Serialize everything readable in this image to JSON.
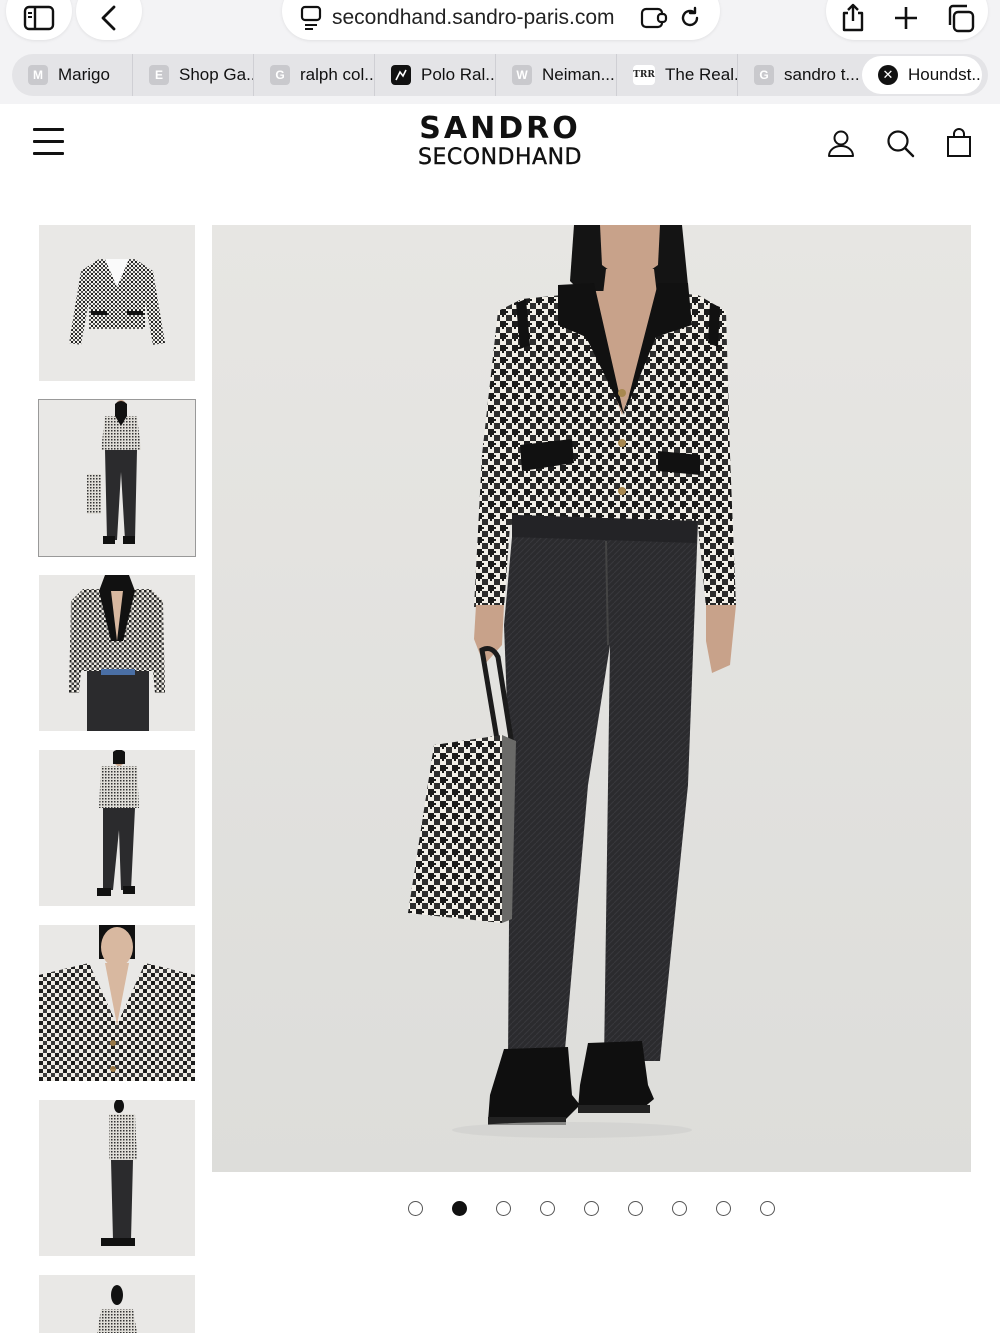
{
  "browser": {
    "url": "secondhand.sandro-paris.com",
    "tabs": [
      {
        "favicon": "M",
        "label": "Marigo",
        "active": false
      },
      {
        "favicon": "E",
        "label": "Shop Ga...",
        "active": false
      },
      {
        "favicon": "G",
        "label": "ralph col...",
        "active": false
      },
      {
        "favicon": "polo-logo",
        "label": "Polo Ral...",
        "active": false
      },
      {
        "favicon": "W",
        "label": "Neiman...",
        "active": false
      },
      {
        "favicon": "TRR",
        "label": "The Real...",
        "active": false
      },
      {
        "favicon": "G",
        "label": "sandro t...",
        "active": false
      },
      {
        "favicon": "close-icon",
        "label": "Houndst...",
        "active": true
      }
    ],
    "icons": [
      "sidebar-icon",
      "back-icon",
      "reader-icon",
      "extensions-icon",
      "reload-icon",
      "share-icon",
      "new-tab-icon",
      "tabs-overview-icon"
    ]
  },
  "header": {
    "logo_line1": "SANDRO",
    "logo_line2": "SECONDHAND",
    "icons": [
      "menu-icon",
      "account-icon",
      "search-icon",
      "bag-icon"
    ]
  },
  "gallery": {
    "thumbnail_count": 7,
    "selected_thumbnail": 2,
    "image_count": 9,
    "active_image": 2,
    "colors": {
      "background": "#e8e7e5",
      "jacket": "houndstooth black/white",
      "jeans": "#2b2b2d",
      "boots": "#111111"
    }
  }
}
